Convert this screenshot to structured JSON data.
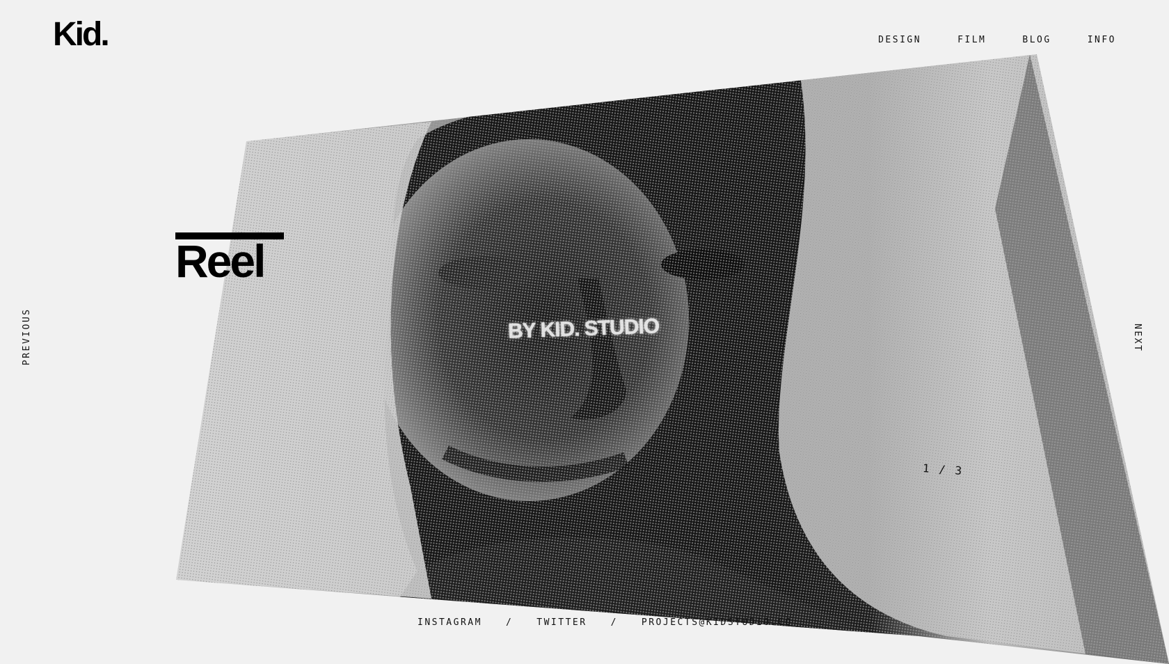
{
  "brand": {
    "logo_text": "Kid."
  },
  "nav": {
    "items": [
      {
        "label": "DESIGN"
      },
      {
        "label": "FILM"
      },
      {
        "label": "BLOG"
      },
      {
        "label": "INFO"
      }
    ]
  },
  "slide": {
    "title": "Reel",
    "caption": "BY KID. STUDIO",
    "counter": "1 / 3"
  },
  "side_nav": {
    "previous": "PREVIOUS",
    "next": "NEXT"
  },
  "footer": {
    "instagram": "INSTAGRAM",
    "twitter": "TWITTER",
    "email": "PROJECTS@KIDSTUDIO.CO",
    "separator": "/"
  },
  "colors": {
    "background": "#f1f1f1",
    "text": "#111111",
    "image_dark": "#0a0a0a",
    "image_light": "#d8d8d8"
  }
}
